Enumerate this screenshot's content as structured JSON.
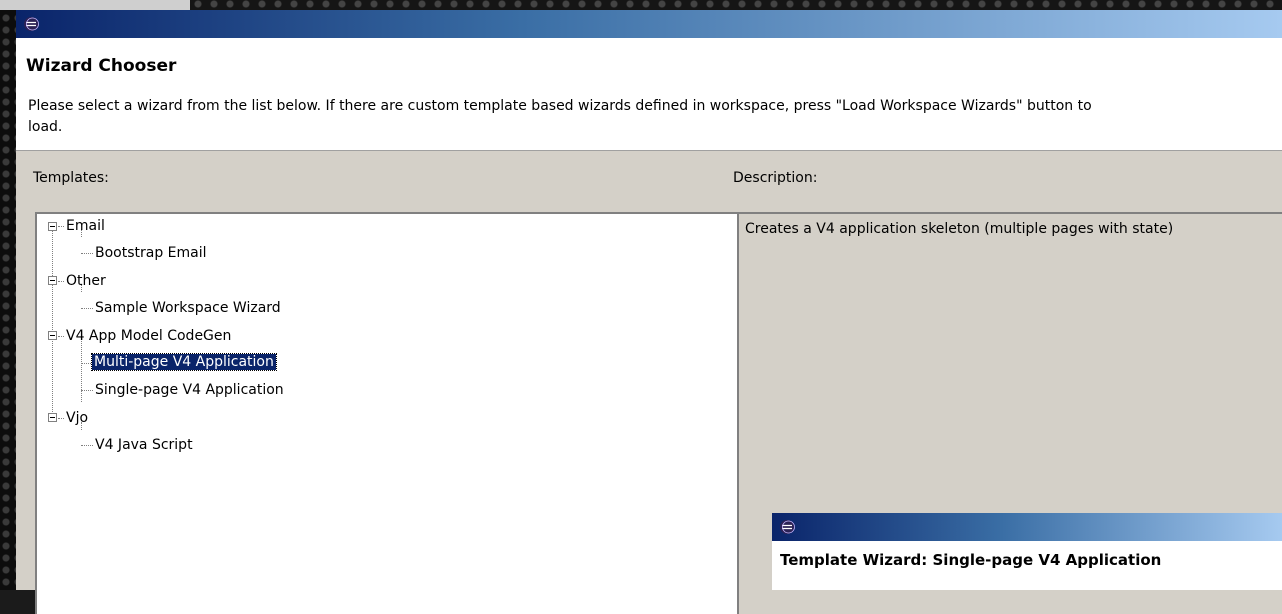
{
  "dialog": {
    "icon": "eclipse-icon",
    "header_title": "Wizard Chooser",
    "header_description_line1": "Please select a wizard from the list below.  If there are custom template based wizards defined in workspace, press \"Load Workspace Wizards\" button to",
    "header_description_line2": "load."
  },
  "templates": {
    "label": "Templates:",
    "tree": [
      {
        "label": "Email",
        "expanded": true,
        "children": [
          "Bootstrap Email"
        ]
      },
      {
        "label": "Other",
        "expanded": true,
        "children": [
          "Sample Workspace Wizard"
        ]
      },
      {
        "label": "V4 App Model CodeGen",
        "expanded": true,
        "children": [
          "Multi-page V4 Application",
          "Single-page V4 Application"
        ]
      },
      {
        "label": "Vjo",
        "expanded": true,
        "children": [
          "V4 Java Script"
        ]
      }
    ],
    "selected": "Multi-page V4 Application"
  },
  "description": {
    "label": "Description:",
    "text": "Creates a V4 application skeleton (multiple pages with state)"
  },
  "sub_dialog": {
    "icon": "eclipse-icon",
    "title": "Template Wizard: Single-page V4 Application"
  },
  "colors": {
    "titlebar_start": "#0a246a",
    "titlebar_end": "#a6caf0",
    "selection": "#0a246a",
    "dialog_bg": "#d4d0c8"
  }
}
